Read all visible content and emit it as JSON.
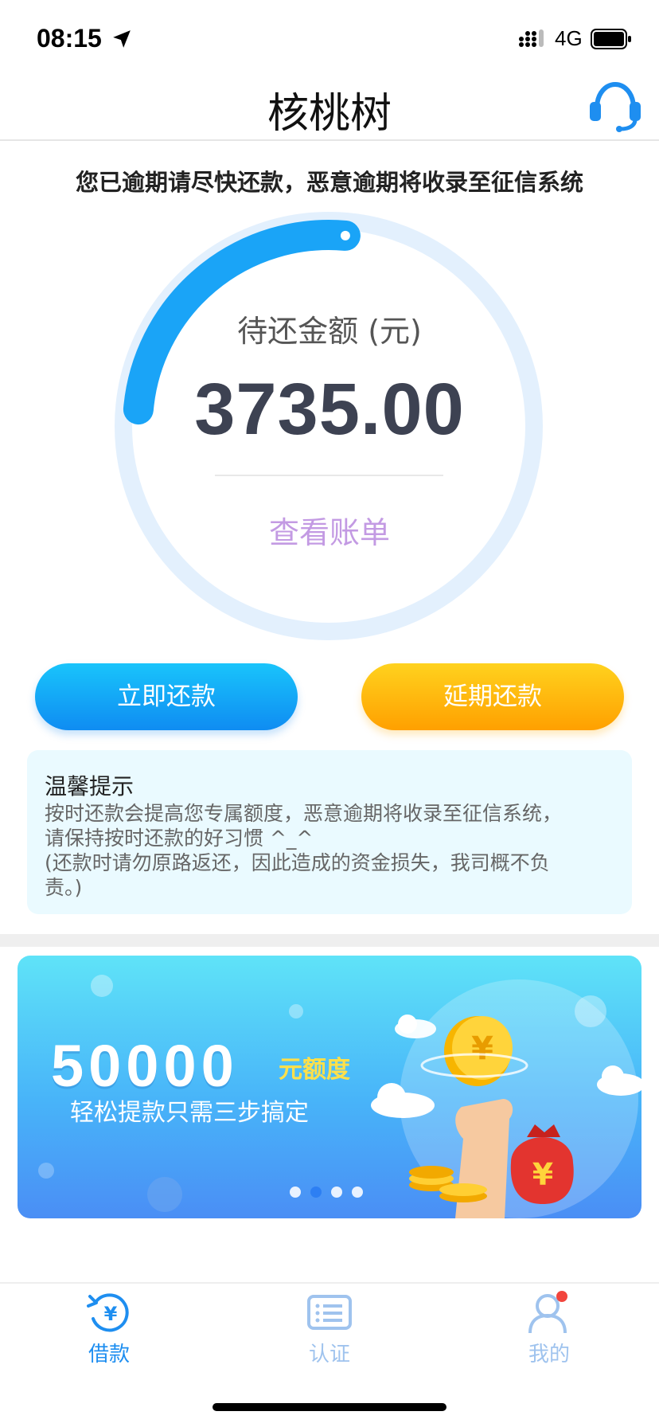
{
  "status_bar": {
    "time": "08:15",
    "network": "4G"
  },
  "nav": {
    "title": "核桃树",
    "support_icon": "headset-icon"
  },
  "warning": "您已逾期请尽快还款，恶意逾期将收录至征信系统",
  "gauge": {
    "caption": "待还金额 (元)",
    "amount": "3735.00",
    "progress_fraction": 0.25,
    "view_bill": "查看账单"
  },
  "actions": {
    "repay_now": "立即还款",
    "repay_later": "延期还款"
  },
  "tips": {
    "title": "温馨提示",
    "line1": "按时还款会提高您专属额度，恶意逾期将收录至征信系统，",
    "line2": "请保持按时还款的好习惯 ^_^",
    "line3": "(还款时请勿原路返还，因此造成的资金损失，我司概不负",
    "line4": "责。)"
  },
  "banner": {
    "amount": "50000",
    "unit": "元额度",
    "subtitle": "轻松提款只需三步搞定",
    "slides": 4,
    "active_slide": 2
  },
  "tabs": [
    {
      "label": "借款",
      "icon": "loan-yen-icon",
      "active": true
    },
    {
      "label": "认证",
      "icon": "verify-list-icon",
      "active": false
    },
    {
      "label": "我的",
      "icon": "profile-icon",
      "active": false,
      "badge": true
    }
  ],
  "colors": {
    "accent_blue": "#1e8ef0",
    "accent_orange": "#ffa000",
    "view_bill": "#c39ae3",
    "tab_inactive": "#9fc3ee"
  }
}
